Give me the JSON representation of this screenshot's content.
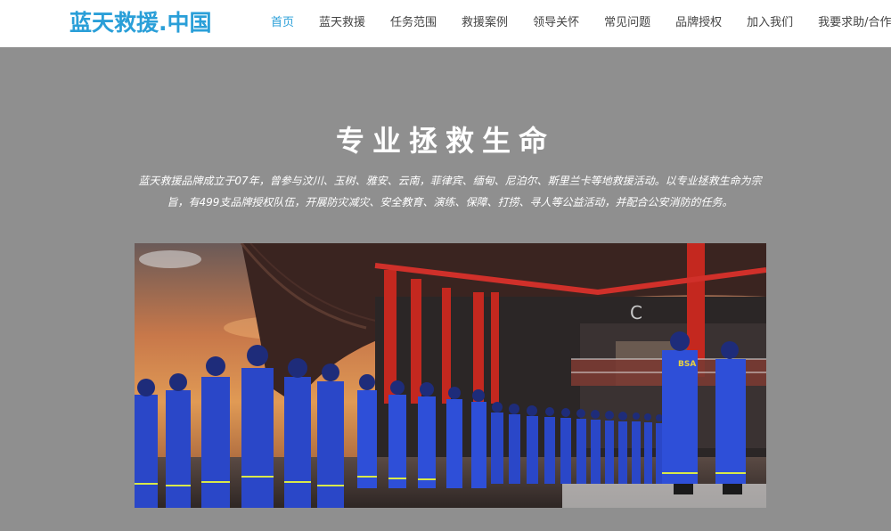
{
  "header": {
    "logo": "蓝天救援.中国",
    "nav": [
      {
        "label": "首页",
        "active": true
      },
      {
        "label": "蓝天救援",
        "active": false
      },
      {
        "label": "任务范围",
        "active": false
      },
      {
        "label": "救援案例",
        "active": false
      },
      {
        "label": "领导关怀",
        "active": false
      },
      {
        "label": "常见问题",
        "active": false
      },
      {
        "label": "品牌授权",
        "active": false
      },
      {
        "label": "加入我们",
        "active": false
      },
      {
        "label": "我要求助/合作",
        "active": false
      }
    ]
  },
  "hero": {
    "title": "专业拯救生命",
    "description": "蓝天救援品牌成立于07年，曾参与汶川、玉树、雅安、云南，菲律宾、缅甸、尼泊尔、斯里兰卡等地救援活动。以专业拯救生命为宗旨，有499支品牌授权队伍，开展防灾减灾、安全教育、演练、保障、打捞、寻人等公益活动，并配合公安消防的任务。",
    "photo_text": {
      "vest": "BSA",
      "sign": "C"
    }
  },
  "colors": {
    "accent": "#2a9fd8",
    "uniform": "#2a47c8",
    "pillar": "#c4281f",
    "background": "#8f8f8f"
  }
}
